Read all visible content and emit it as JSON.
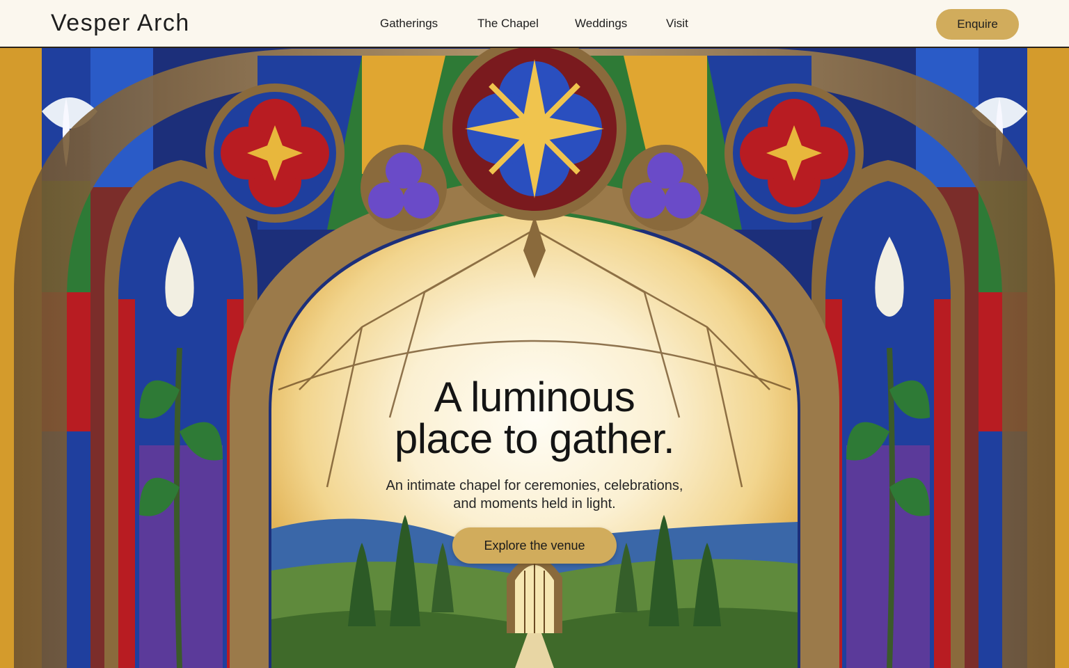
{
  "brand": {
    "name": "Vesper Arch"
  },
  "nav": {
    "links": [
      "Gatherings",
      "The Chapel",
      "Weddings",
      "Visit"
    ],
    "cta_label": "Enquire"
  },
  "hero": {
    "headline_line1": "A luminous",
    "headline_line2": "place to gather.",
    "subtitle_line1": "An intimate chapel for ceremonies, celebrations,",
    "subtitle_line2": "and moments held in light.",
    "cta_label": "Explore the venue"
  },
  "colors": {
    "nav_background": "#fbf7ee",
    "accent_gold": "#d1ac5c",
    "text_dark": "#1e1e1e",
    "glass_red": "#b81c22",
    "glass_blue": "#1f3f9e",
    "glass_green": "#2e7a36",
    "glass_amber": "#e0a631",
    "stone": "#9b7a4a"
  }
}
